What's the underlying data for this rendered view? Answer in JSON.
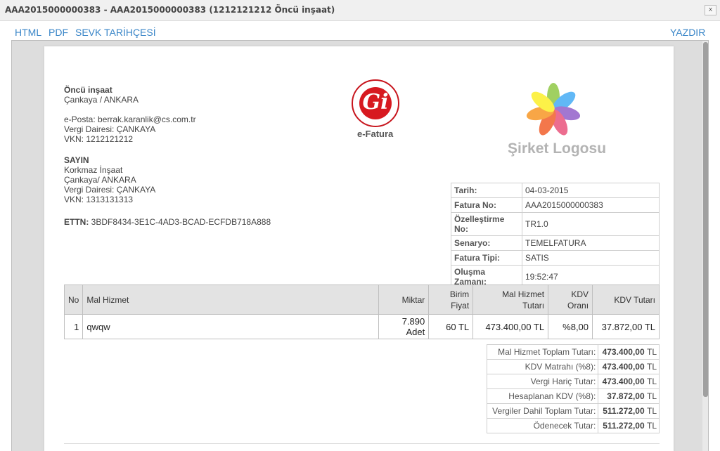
{
  "window": {
    "title": "AAA2015000000383 - AAA2015000000383 (1212121212 Öncü inşaat)",
    "close_label": "x"
  },
  "links": {
    "html": "HTML",
    "pdf": "PDF",
    "sevk": "SEVK TARİHÇESİ",
    "print": "YAZDIR"
  },
  "seller": {
    "name": "Öncü inşaat",
    "address": "Çankaya / ANKARA",
    "email": "e-Posta: berrak.karanlik@cs.com.tr",
    "tax_office": "Vergi Dairesi: ÇANKAYA",
    "vkn": "VKN: 1212121212"
  },
  "buyer": {
    "heading": "SAYIN",
    "name": "Korkmaz İnşaat",
    "address": "Çankaya/ ANKARA",
    "tax_office": "Vergi Dairesi: ÇANKAYA",
    "vkn": "VKN: 1313131313"
  },
  "ettn": {
    "label": "ETTN:",
    "value": "3BDF8434-3E1C-4AD3-BCAD-ECFDB718A888"
  },
  "efatura_label": "e-Fatura",
  "company_logo_text": "Şirket Logosu",
  "invoice_info": [
    {
      "label": "Tarih:",
      "value": "04-03-2015"
    },
    {
      "label": "Fatura No:",
      "value": "AAA2015000000383"
    },
    {
      "label": "Özelleştirme No:",
      "value": "TR1.0"
    },
    {
      "label": "Senaryo:",
      "value": "TEMELFATURA"
    },
    {
      "label": "Fatura Tipi:",
      "value": "SATIS"
    },
    {
      "label": "Oluşma Zamanı:",
      "value": "19:52:47"
    }
  ],
  "items_table": {
    "headers": [
      "No",
      "Mal Hizmet",
      "Miktar",
      "Birim Fiyat",
      "Mal Hizmet Tutarı",
      "KDV Oranı",
      "KDV Tutarı"
    ],
    "header_lines": [
      [
        "No"
      ],
      [
        "Mal Hizmet"
      ],
      [
        "Miktar"
      ],
      [
        "Birim",
        "Fiyat"
      ],
      [
        "Mal Hizmet",
        "Tutarı"
      ],
      [
        "KDV",
        "Oranı"
      ],
      [
        "KDV Tutarı"
      ]
    ],
    "rows": [
      {
        "no": "1",
        "name": "qwqw",
        "qty": "7.890 Adet",
        "unit_price": "60 TL",
        "amount": "473.400,00 TL",
        "vat_rate": "%8,00",
        "vat_amount": "37.872,00 TL"
      }
    ]
  },
  "totals": [
    {
      "label": "Mal Hizmet Toplam Tutarı:",
      "value": "473.400,00",
      "currency": "TL"
    },
    {
      "label": "KDV Matrahı (%8):",
      "value": "473.400,00",
      "currency": "TL"
    },
    {
      "label": "Vergi Hariç Tutar:",
      "value": "473.400,00",
      "currency": "TL"
    },
    {
      "label": "Hesaplanan KDV (%8):",
      "value": "37.872,00",
      "currency": "TL"
    },
    {
      "label": "Vergiler Dahil Toplam Tutar:",
      "value": "511.272,00",
      "currency": "TL"
    },
    {
      "label": "Ödenecek Tutar:",
      "value": "511.272,00",
      "currency": "TL"
    }
  ],
  "colors": {
    "link": "#3a86c8",
    "seal_red": "#d71920",
    "logo_gray": "#b3b3b3"
  }
}
